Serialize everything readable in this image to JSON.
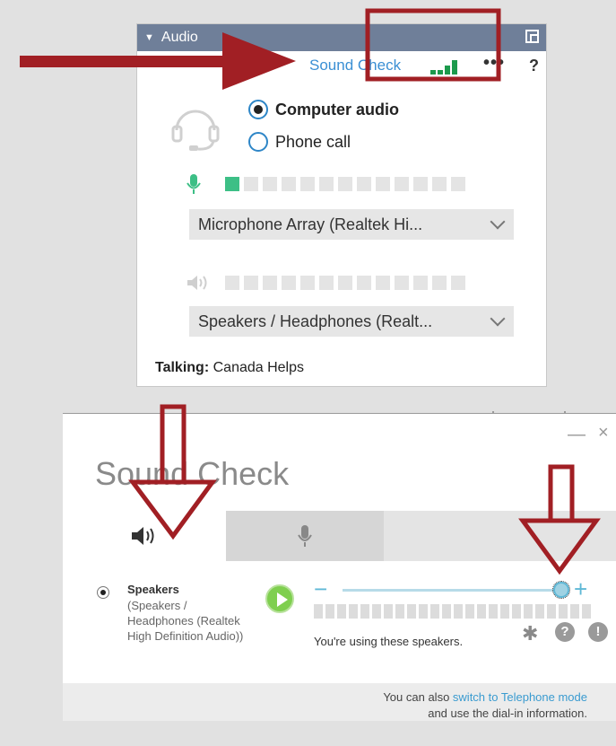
{
  "audio_panel": {
    "title": "Audio",
    "sound_check_link": "Sound Check",
    "more_label": "•••",
    "help_label": "?",
    "options": [
      {
        "label": "Computer audio",
        "selected": true
      },
      {
        "label": "Phone call",
        "selected": false
      }
    ],
    "microphone": {
      "device": "Microphone Array (Realtek Hi...",
      "level_segments": 13,
      "level_active": 1
    },
    "speakers": {
      "device": "Speakers / Headphones (Realt...",
      "level_segments": 13,
      "level_active": 0
    },
    "talking_label": "Talking:",
    "talking_name": "Canada Helps",
    "header_color": "#6f7f99",
    "accent_color": "#2e86c7",
    "signal_color": "#1c9a4c"
  },
  "sound_check": {
    "title": "Sound Check",
    "minimize_label": "—",
    "close_label": "×",
    "tabs": [
      {
        "icon": "speaker-icon",
        "active": true
      },
      {
        "icon": "microphone-icon",
        "active": false
      }
    ],
    "speaker_name": "Speakers",
    "speaker_desc": "(Speakers / Headphones (Realtek High Definition Audio))",
    "volume_minus": "−",
    "volume_plus": "+",
    "volume_fraction": 1.0,
    "level_segments": 24,
    "status_text": "You're using these speakers.",
    "help_label": "?",
    "info_label": "!",
    "footer_prefix": "You can also ",
    "footer_link": "switch to Telephone mode",
    "footer_line2": "and use the dial-in information."
  },
  "annotation_color": "#a11f24"
}
